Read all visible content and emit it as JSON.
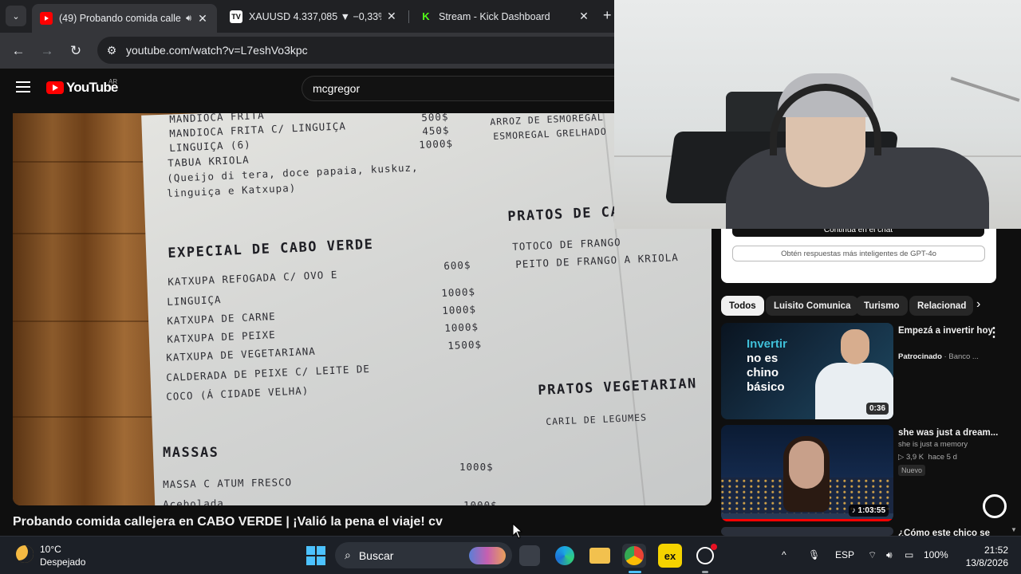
{
  "browser": {
    "tabs": [
      {
        "title": "(49) Probando comida calle",
        "active": true,
        "favicon": "youtube-icon",
        "extra_icon": "speaker-icon"
      },
      {
        "title": "XAUUSD 4.337,085 ▼ −0,33% S",
        "active": false,
        "favicon": "tradingview-icon"
      },
      {
        "title": "Stream - Kick Dashboard",
        "active": false,
        "favicon": "kick-icon"
      }
    ],
    "new_tab_symbol": "+",
    "url": "youtube.com/watch?v=L7eshVo3kpc"
  },
  "youtube": {
    "logo_text": "YouTube",
    "country_code": "AR",
    "search_value": "mcgregor",
    "video_title": "Probando comida callejera en CABO VERDE | ¡Valió la pena el viaje! cv",
    "menu": {
      "top_items": [
        {
          "name": "MANDIOCA FRITA",
          "price": "500$"
        },
        {
          "name": "MANDIOCA FRITA C/ LINGUIÇA",
          "price": "450$"
        },
        {
          "name": "LINGUIÇA (6)",
          "price": "1000$"
        },
        {
          "name": "TABUA KRIOLA",
          "price": ""
        },
        {
          "name": "(Queijo di tera, doce papaia, kuskuz,",
          "price": ""
        },
        {
          "name": "linguiça e Katxupa)",
          "price": ""
        }
      ],
      "section_especial": "EXPECIAL DE CABO VERDE",
      "especial_items": [
        {
          "name": "KATXUPA REFOGADA C/ OVO E",
          "price": "600$"
        },
        {
          "name": "LINGUIÇA",
          "price": ""
        },
        {
          "name": "KATXUPA DE CARNE",
          "price": "1000$"
        },
        {
          "name": "KATXUPA DE PEIXE",
          "price": "1000$"
        },
        {
          "name": "KATXUPA DE VEGETARIANA",
          "price": "1000$"
        },
        {
          "name": "CALDERADA DE PEIXE C/ LEITE DE",
          "price": "1500$"
        },
        {
          "name": "COCO (Á CIDADE VELHA)",
          "price": ""
        }
      ],
      "section_massas": "MASSAS",
      "massas_items": [
        {
          "name": "MASSA C ATUM FRESCO",
          "price": "1000$"
        },
        {
          "name": "Acebolada",
          "price": "1000$"
        }
      ],
      "right_top": [
        "ARROZ DE ESMOREGAL",
        "ESMOREGAL GRELHADO"
      ],
      "section_pratos": "PRATOS DE CA",
      "pratos_items": [
        "TOTOCO DE FRANGO",
        "PEITO DE FRANGO A KRIOLA"
      ],
      "section_veg": "PRATOS VEGETARIAN",
      "veg_items": [
        "CARIL DE LEGUMES"
      ]
    },
    "gpt_card": {
      "continue_label": "Continúa en el chat",
      "cta_label": "Obtén respuestas más inteligentes de GPT-4o"
    },
    "chips": [
      "Todos",
      "Luisito Comunica",
      "Turismo",
      "Relacionad"
    ],
    "recommendations": [
      {
        "thumb_text": [
          "Invertir",
          "no es",
          "chino",
          "básico"
        ],
        "duration": "0:36",
        "title": "Empezá a invertir hoy",
        "meta1": "Patrocinado",
        "meta2": "Banco ..."
      },
      {
        "duration": "1:03:55",
        "title": "she was just a dream...",
        "channel": "she is just a memory",
        "views": "3,9 K",
        "age": "hace 5 d",
        "badge": "Nuevo",
        "watched_fraction": 1.0
      },
      {
        "title": "¿Cómo este chico se"
      }
    ]
  },
  "taskbar": {
    "weather_temp": "10°C",
    "weather_desc": "Despejado",
    "search_placeholder": "Buscar",
    "language": "ESP",
    "battery": "100%",
    "time": "21:52",
    "date": "13/8/2026",
    "excel_label": "ex"
  },
  "colors": {
    "youtube_red": "#ff0000",
    "chrome_dark": "#202124",
    "chrome_toolbar": "#35363a",
    "yt_bg": "#0f0f0f",
    "win_accent": "#4cc2ff"
  }
}
